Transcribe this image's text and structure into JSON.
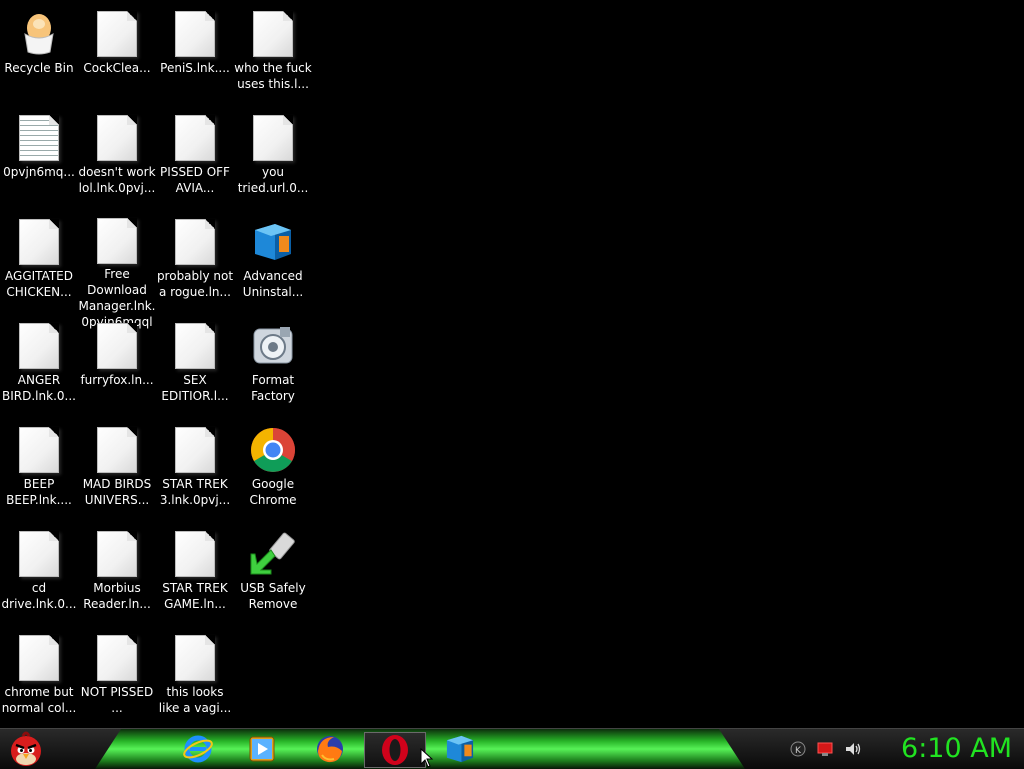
{
  "desktop": {
    "icons": [
      {
        "label": "Recycle Bin",
        "icon": "recycle-bin-egg-icon"
      },
      {
        "label": "CockClea...",
        "icon": "blank-file-icon"
      },
      {
        "label": "PeniS.lnk....",
        "icon": "blank-file-icon"
      },
      {
        "label": "who the fuck uses this.l...",
        "icon": "blank-file-icon"
      },
      {
        "label": "0pvjn6mq...",
        "icon": "text-document-icon"
      },
      {
        "label": "doesn't work lol.lnk.0pvj...",
        "icon": "blank-file-icon"
      },
      {
        "label": "PISSED OFF AVIA...",
        "icon": "blank-file-icon"
      },
      {
        "label": "you tried.url.0...",
        "icon": "blank-file-icon"
      },
      {
        "label": "AGGITATED CHICKEN...",
        "icon": "blank-file-icon"
      },
      {
        "label": "Free Download Manager.lnk. 0pvjn6mqql",
        "icon": "blank-file-icon"
      },
      {
        "label": "probably not a rogue.ln...",
        "icon": "blank-file-icon"
      },
      {
        "label": "Advanced Uninstal...",
        "icon": "advanced-uninstaller-icon"
      },
      {
        "label": "ANGER BIRD.lnk.0...",
        "icon": "blank-file-icon"
      },
      {
        "label": "furryfox.ln...",
        "icon": "blank-file-icon"
      },
      {
        "label": "SEX EDITIOR.l...",
        "icon": "blank-file-icon"
      },
      {
        "label": "Format Factory",
        "icon": "format-factory-icon"
      },
      {
        "label": "BEEP BEEP.lnk....",
        "icon": "blank-file-icon"
      },
      {
        "label": "MAD BIRDS UNIVERS...",
        "icon": "blank-file-icon"
      },
      {
        "label": "STAR TREK 3.lnk.0pvj...",
        "icon": "blank-file-icon"
      },
      {
        "label": "Google Chrome",
        "icon": "chrome-icon"
      },
      {
        "label": "cd drive.lnk.0...",
        "icon": "blank-file-icon"
      },
      {
        "label": "Morbius Reader.ln...",
        "icon": "blank-file-icon"
      },
      {
        "label": "STAR TREK GAME.ln...",
        "icon": "blank-file-icon"
      },
      {
        "label": "USB Safely Remove",
        "icon": "usb-safely-remove-icon"
      },
      {
        "label": "chrome but normal col...",
        "icon": "blank-file-icon"
      },
      {
        "label": "NOT PISSED ...",
        "icon": "blank-file-icon"
      },
      {
        "label": "this looks like a vagi...",
        "icon": "blank-file-icon"
      }
    ]
  },
  "taskbar": {
    "start_icon": "angry-bird-start-icon",
    "pinned": [
      {
        "icon": "internet-explorer-icon"
      },
      {
        "icon": "media-player-icon"
      },
      {
        "icon": "firefox-icon"
      },
      {
        "icon": "opera-icon",
        "active": true
      },
      {
        "icon": "advanced-uninstaller-icon"
      }
    ],
    "tray": [
      {
        "icon": "keyboard-language-icon"
      },
      {
        "icon": "network-icon"
      },
      {
        "icon": "volume-icon"
      }
    ],
    "clock": "6:10 AM",
    "accent": "#21e321"
  }
}
